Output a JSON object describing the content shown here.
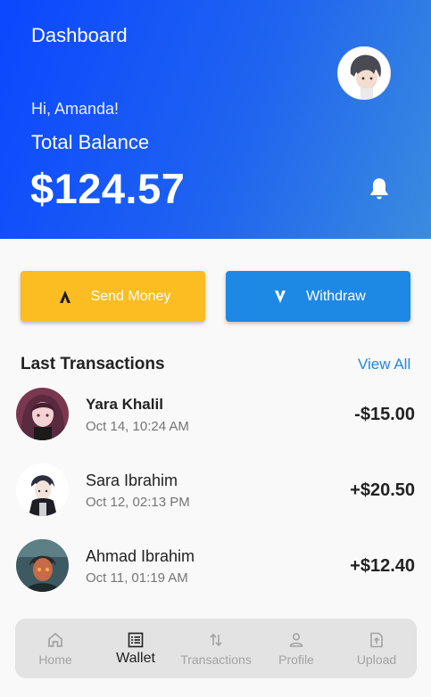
{
  "header": {
    "title": "Dashboard",
    "greeting": "Hi, Amanda!",
    "balance_label": "Total Balance",
    "balance_amount": "$124.57"
  },
  "actions": {
    "send_label": "Send Money",
    "withdraw_label": "Withdraw"
  },
  "transactions_section": {
    "title": "Last Transactions",
    "view_all": "View All",
    "items": [
      {
        "name": "Yara Khalil",
        "date": "Oct 14, 10:24 AM",
        "amount": "-$15.00"
      },
      {
        "name": "Sara Ibrahim",
        "date": "Oct 12, 02:13 PM",
        "amount": "+$20.50"
      },
      {
        "name": "Ahmad Ibrahim",
        "date": "Oct 11, 01:19 AM",
        "amount": "+$12.40"
      }
    ]
  },
  "nav": {
    "items": [
      {
        "label": "Home",
        "icon": "home-icon"
      },
      {
        "label": "Wallet",
        "icon": "wallet-icon"
      },
      {
        "label": "Transactions",
        "icon": "transactions-icon"
      },
      {
        "label": "Profile",
        "icon": "profile-icon"
      },
      {
        "label": "Upload",
        "icon": "upload-icon"
      }
    ],
    "active": "Wallet"
  },
  "colors": {
    "header_start": "#0b47ff",
    "header_end": "#3a8cdf",
    "send_button": "#fbbd21",
    "withdraw_button": "#1e88e5",
    "link": "#1e88e5"
  }
}
